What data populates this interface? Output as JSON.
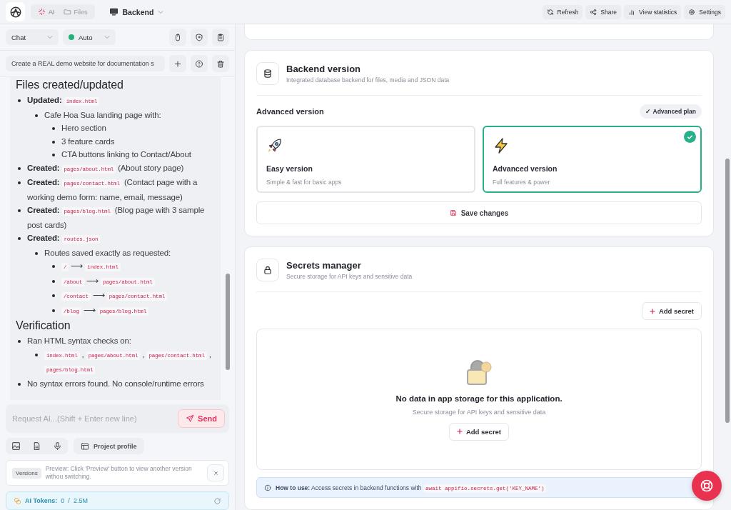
{
  "topbar": {
    "tabs": [
      {
        "label": "AI",
        "selected": true
      },
      {
        "label": "Files",
        "selected": false
      }
    ],
    "project": "Backend",
    "actions": [
      "Refresh",
      "Share",
      "View statistics",
      "Settings"
    ]
  },
  "chat_controls": {
    "mode": "Chat",
    "model": "Auto",
    "conversation": "Create a REAL demo website for documentation s"
  },
  "message": {
    "sections": [
      {
        "heading": "Files created/updated",
        "items": [
          {
            "parts": [
              {
                "kind": "bold",
                "text": "Updated:"
              },
              {
                "kind": "code",
                "text": "index.html"
              }
            ],
            "children": [
              {
                "parts": [
                  {
                    "kind": "text",
                    "text": "Cafe Hoa Sua landing page with:"
                  }
                ],
                "children": [
                  {
                    "parts": [
                      {
                        "kind": "text",
                        "text": "Hero section"
                      }
                    ]
                  },
                  {
                    "parts": [
                      {
                        "kind": "text",
                        "text": "3 feature cards"
                      }
                    ]
                  },
                  {
                    "parts": [
                      {
                        "kind": "text",
                        "text": "CTA buttons linking to Contact/About"
                      }
                    ]
                  }
                ]
              }
            ]
          },
          {
            "parts": [
              {
                "kind": "bold",
                "text": "Created:"
              },
              {
                "kind": "code",
                "text": "pages/about.html"
              },
              {
                "kind": "text",
                "text": "(About story page)"
              }
            ]
          },
          {
            "parts": [
              {
                "kind": "bold",
                "text": "Created:"
              },
              {
                "kind": "code",
                "text": "pages/contact.html"
              },
              {
                "kind": "text",
                "text": "(Contact page with a working demo form: name, email, message)"
              }
            ]
          },
          {
            "parts": [
              {
                "kind": "bold",
                "text": "Created:"
              },
              {
                "kind": "code",
                "text": "pages/blog.html"
              },
              {
                "kind": "text",
                "text": "(Blog page with 3 sample post cards)"
              }
            ]
          },
          {
            "parts": [
              {
                "kind": "bold",
                "text": "Created:"
              },
              {
                "kind": "code",
                "text": "routes.json"
              }
            ],
            "children": [
              {
                "parts": [
                  {
                    "kind": "text",
                    "text": "Routes saved exactly as requested:"
                  }
                ],
                "children": [
                  {
                    "parts": [
                      {
                        "kind": "code",
                        "text": "/"
                      },
                      {
                        "kind": "text",
                        "text": "⟶"
                      },
                      {
                        "kind": "code",
                        "text": "index.html"
                      }
                    ]
                  },
                  {
                    "parts": [
                      {
                        "kind": "code",
                        "text": "/about"
                      },
                      {
                        "kind": "text",
                        "text": "⟶"
                      },
                      {
                        "kind": "code",
                        "text": "pages/about.html"
                      }
                    ]
                  },
                  {
                    "parts": [
                      {
                        "kind": "code",
                        "text": "/contact"
                      },
                      {
                        "kind": "text",
                        "text": "⟶"
                      },
                      {
                        "kind": "code",
                        "text": "pages/contact.html"
                      }
                    ]
                  },
                  {
                    "parts": [
                      {
                        "kind": "code",
                        "text": "/blog"
                      },
                      {
                        "kind": "text",
                        "text": "⟶"
                      },
                      {
                        "kind": "code",
                        "text": "pages/blog.html"
                      }
                    ]
                  }
                ]
              }
            ]
          }
        ]
      },
      {
        "heading": "Verification",
        "items": [
          {
            "parts": [
              {
                "kind": "text",
                "text": "Ran HTML syntax checks on:"
              }
            ],
            "children": [
              {
                "parts": [
                  {
                    "kind": "code",
                    "text": "index.html"
                  },
                  {
                    "kind": "text",
                    "text": ","
                  },
                  {
                    "kind": "code",
                    "text": "pages/about.html"
                  },
                  {
                    "kind": "text",
                    "text": ","
                  },
                  {
                    "kind": "code",
                    "text": "pages/contact.html"
                  },
                  {
                    "kind": "text",
                    "text": ","
                  },
                  {
                    "kind": "code",
                    "text": "pages/blog.html"
                  }
                ]
              }
            ]
          },
          {
            "parts": [
              {
                "kind": "text",
                "text": "No syntax errors found. No console/runtime errors"
              }
            ]
          }
        ]
      }
    ]
  },
  "composer": {
    "placeholder": "Request AI...(Shift + Enter new line)",
    "send": "Send",
    "profile": "Project profile"
  },
  "notice": {
    "badge": "Versions",
    "text": "Preview: Click 'Preview' button to view another version withou switching."
  },
  "tokens": {
    "label": "AI Tokens:",
    "used": "0",
    "separator": "/",
    "total": "2.5M"
  },
  "backend": {
    "title": "Backend version",
    "subtitle": "Integrated database backend for files, media and JSON data",
    "section_label": "Advanced version",
    "plan_badge": "✓ Advanced plan",
    "options": [
      {
        "title": "Easy version",
        "description": "Simple & fast for basic apps",
        "selected": false
      },
      {
        "title": "Advanced version",
        "description": "Full features & power",
        "selected": true
      }
    ],
    "save": "Save changes"
  },
  "secrets": {
    "title": "Secrets manager",
    "subtitle": "Secure storage for API keys and sensitive data",
    "add": "Add secret",
    "empty": {
      "title": "No data in app storage for this application.",
      "subtitle": "Secure storage for API keys and sensitive data",
      "button": "Add secret"
    },
    "howto": {
      "label": "How to use:",
      "text": "Access secrets in backend functions with",
      "code": "await appifio.secrets.get('KEY_NAME')"
    }
  }
}
